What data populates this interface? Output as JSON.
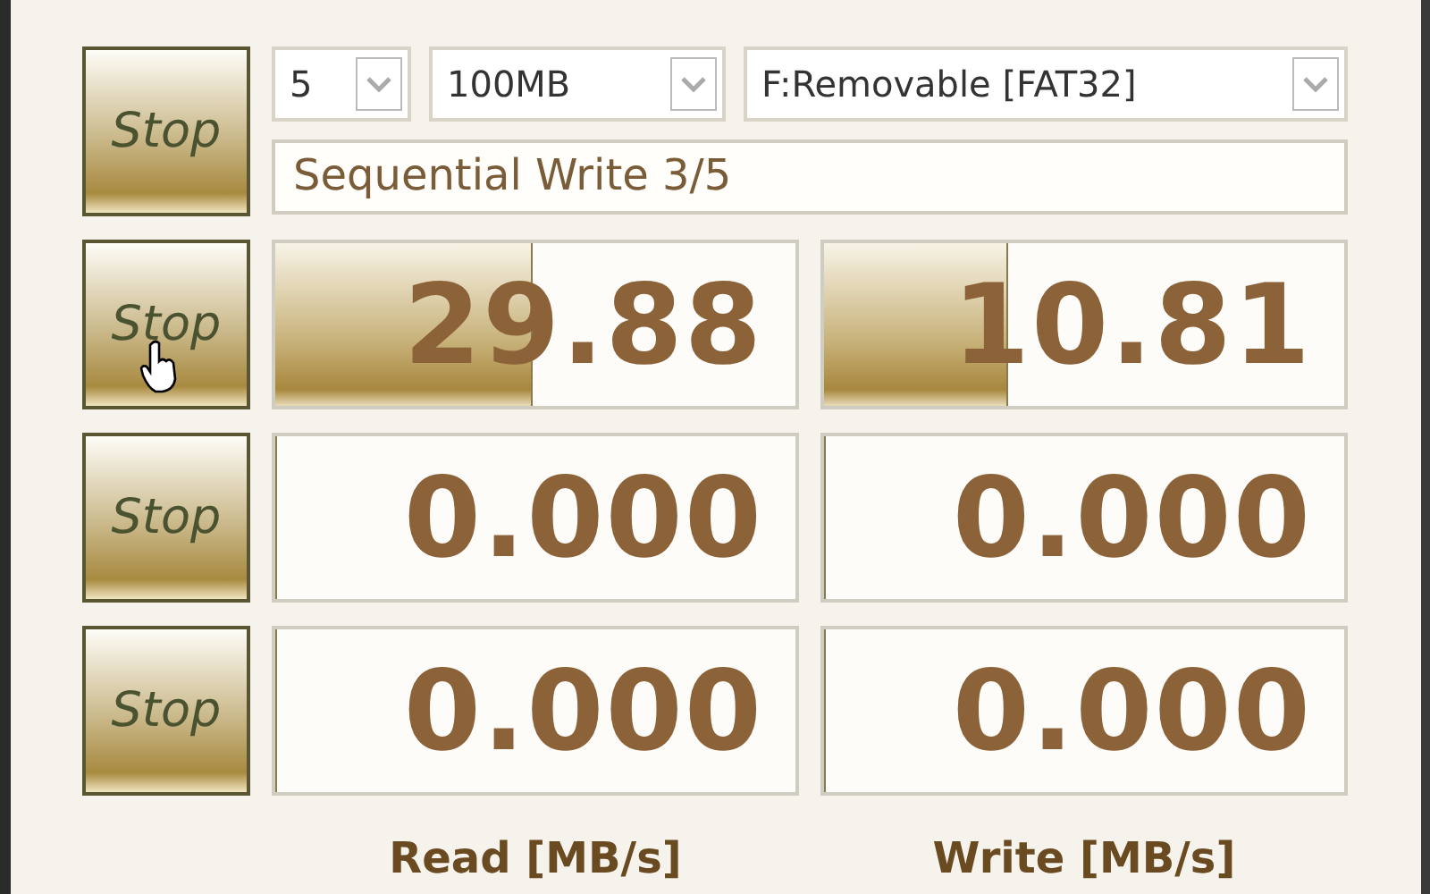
{
  "settings": {
    "count": "5",
    "size": "100MB",
    "drive": "F:Removable [FAT32]"
  },
  "status": "Sequential Write 3/5",
  "all_button": "Stop",
  "results": [
    {
      "button": "Stop",
      "read": {
        "value": "29.88",
        "level": 0.49
      },
      "write": {
        "value": "10.81",
        "level": 0.35
      }
    },
    {
      "button": "Stop",
      "read": {
        "value": "0.000",
        "level": 0
      },
      "write": {
        "value": "0.000",
        "level": 0
      }
    },
    {
      "button": "Stop",
      "read": {
        "value": "0.000",
        "level": 0
      },
      "write": {
        "value": "0.000",
        "level": 0
      }
    }
  ],
  "footer": {
    "read": "Read [MB/s]",
    "write": "Write [MB/s]"
  }
}
